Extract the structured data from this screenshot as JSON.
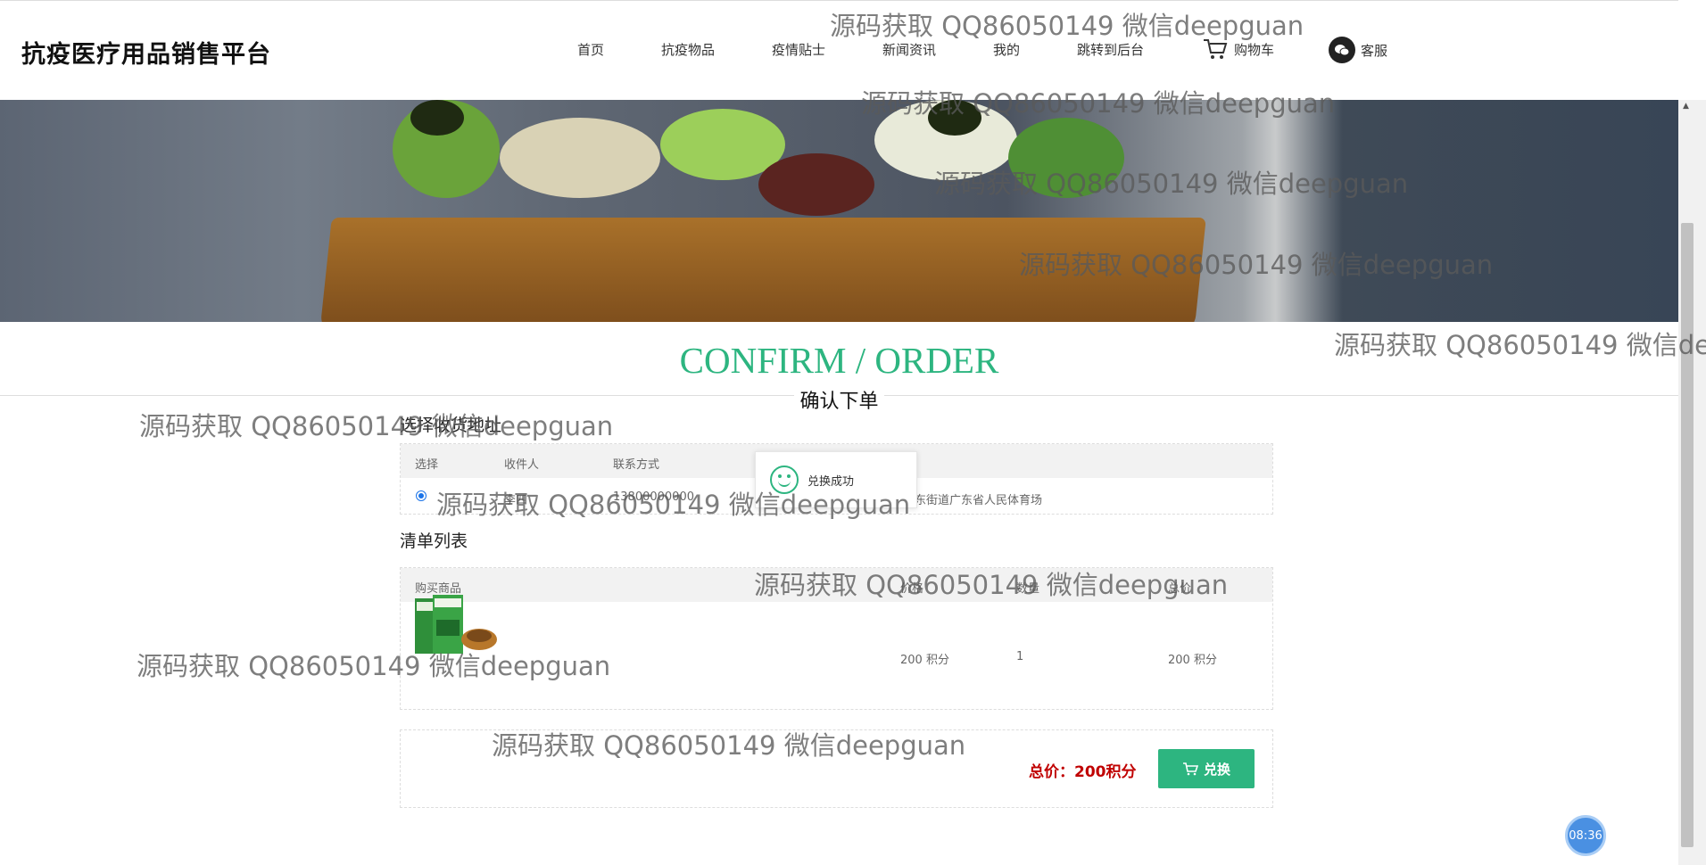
{
  "header": {
    "brand": "抗疫医疗用品销售平台",
    "nav": [
      "首页",
      "抗疫物品",
      "疫情贴士",
      "新闻资讯",
      "我的",
      "跳转到后台"
    ],
    "cart_label": "购物车",
    "service_label": "客服"
  },
  "page": {
    "title_en": "CONFIRM / ORDER",
    "title_cn": "确认下单"
  },
  "address": {
    "section_label": "选择收货地址",
    "columns": [
      "选择",
      "收件人",
      "联系方式"
    ],
    "row": {
      "selected": true,
      "name": "李四",
      "phone": "13800000000",
      "address": "东街道广东省人民体育场"
    }
  },
  "toast": {
    "text": "兑换成功",
    "icon": "smile-icon"
  },
  "order_list": {
    "section_label": "清单列表",
    "columns": [
      "购买商品",
      "价格",
      "数量",
      "总价"
    ],
    "rows": [
      {
        "price": "200 积分",
        "quantity": "1",
        "total": "200 积分"
      }
    ]
  },
  "summary": {
    "total_label": "总价：200积分",
    "button_label": "兑换"
  },
  "clock": "08:36",
  "watermark": "源码获取 QQ86050149 微信deepguan",
  "colors": {
    "accent": "#2db580",
    "price": "#c00000"
  }
}
